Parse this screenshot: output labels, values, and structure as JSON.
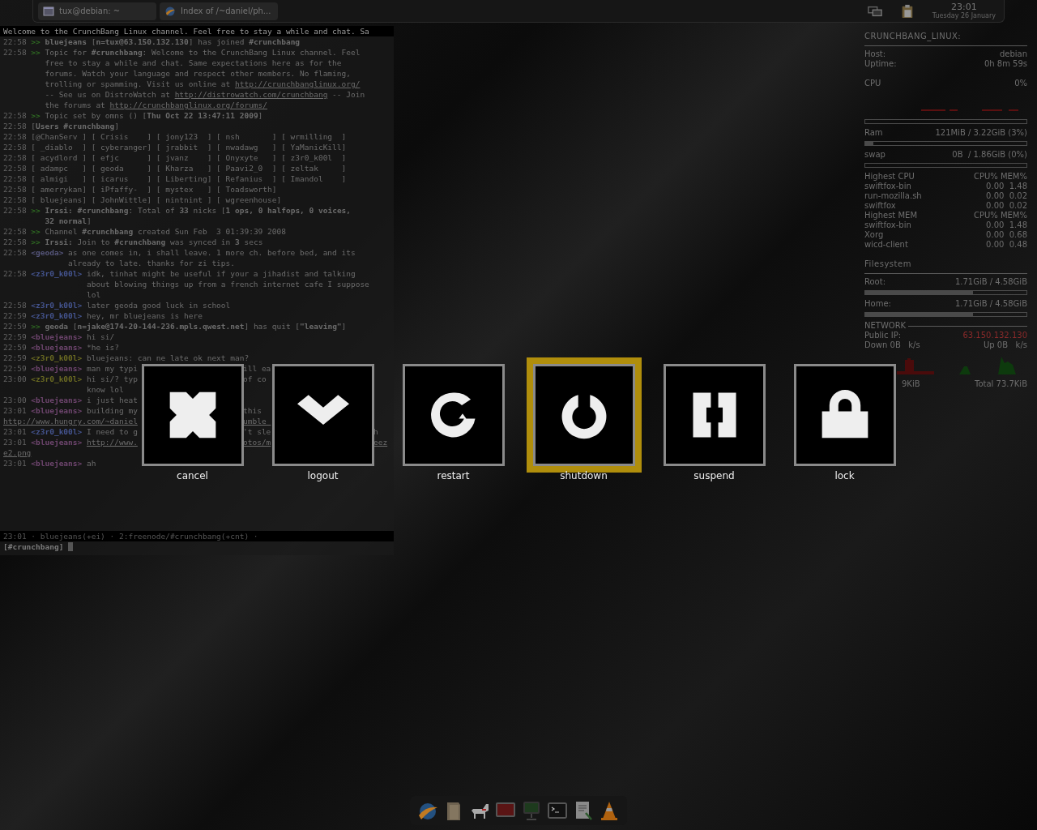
{
  "taskbar": {
    "tasks": [
      {
        "kind": "terminal",
        "title": "tux@debian: ~"
      },
      {
        "kind": "browser",
        "title": "Index of /~daniel/ph..."
      }
    ],
    "clock": {
      "time": "23:01",
      "date": "Tuesday 26 January"
    }
  },
  "terminal": {
    "lines": [
      {
        "kind": "topic-bar",
        "text": "Welcome to the CrunchBang Linux channel. Feel free to stay a while and chat. Sa"
      },
      {
        "kind": "event",
        "time": "22:58",
        "marker": ">>",
        "lines": [
          {
            "text": "**bluejeans** [**n=tux@63.150.132.130**] has joined **#crunchbang**"
          }
        ]
      },
      {
        "kind": "event",
        "time": "22:58",
        "marker": ">>",
        "lines": [
          {
            "text": "Topic for **#crunchbang**: Welcome to the CrunchBang Linux channel. Feel"
          },
          {
            "text": "free to stay a while and chat. Same expectations here as for the"
          },
          {
            "text": "forums. Watch your language and respect other members. No flaming,"
          },
          {
            "text": "trolling or spamming. Visit us online at ",
            "link": "http://crunchbanglinux.org/"
          },
          {
            "text": "-- See us on DistroWatch at ",
            "link": "http://distrowatch.com/crunchbang",
            "after": " -- Join"
          },
          {
            "text": "the forums at ",
            "link": "http://crunchbanglinux.org/forums/"
          }
        ]
      },
      {
        "kind": "event",
        "time": "22:58",
        "marker": ">>",
        "lines": [
          {
            "text": "Topic set by omns () [**Thu Oct 22 13:47:11 2009**]"
          }
        ]
      },
      {
        "kind": "event",
        "time": "22:58",
        "lines": [
          {
            "text": "[**Users #crunchbang**]"
          }
        ]
      },
      {
        "kind": "names",
        "time": "22:58",
        "text": "[@ChanServ ] [ Crisis    ] [ jony123  ] [ nsh       ] [ wrmilling  ]"
      },
      {
        "kind": "names",
        "time": "22:58",
        "text": "[ _diablo  ] [ cyberanger] [ jrabbit  ] [ nwadawg   ] [ YaManicKill]"
      },
      {
        "kind": "names",
        "time": "22:58",
        "text": "[ acydlord ] [ efjc      ] [ jvanz    ] [ Onyxyte   ] [ z3r0_k00l  ]"
      },
      {
        "kind": "names",
        "time": "22:58",
        "text": "[ adampc   ] [ geoda     ] [ Kharza   ] [ Paavi2_0  ] [ zeltak     ]"
      },
      {
        "kind": "names",
        "time": "22:58",
        "text": "[ almigi   ] [ icarus    ] [ Liberting] [ Refanius  ] [ Imandol    ]"
      },
      {
        "kind": "names",
        "time": "22:58",
        "text": "[ amerrykan] [ iPfaffy-  ] [ mystex   ] [ Toadsworth]"
      },
      {
        "kind": "names",
        "time": "22:58",
        "text": "[ bluejeans] [ JohnWittle] [ nintnint ] [ wgreenhouse]"
      },
      {
        "kind": "event",
        "time": "22:58",
        "marker": ">>",
        "lines": [
          {
            "text": "**Irssi:** **#crunchbang**: Total of **33** nicks [**1 ops, 0 halfops, 0 voices,**"
          },
          {
            "text": "**32 normal**]"
          }
        ]
      },
      {
        "kind": "event",
        "time": "22:58",
        "marker": ">>",
        "lines": [
          {
            "text": "Channel **#crunchbang** created Sun Feb  3 01:39:39 2008"
          }
        ]
      },
      {
        "kind": "event",
        "time": "22:58",
        "marker": ">>",
        "lines": [
          {
            "text": "**Irssi:** Join to **#crunchbang** was synced in **3** secs"
          }
        ]
      },
      {
        "kind": "message",
        "time": "22:58",
        "nick": "<geoda>",
        "color": "#55557a",
        "link": false,
        "lines": [
          [
            "as one comes in, i shall leave. 1 more ch. before bed, and its"
          ],
          [
            "already to late. thanks for zi tips."
          ]
        ]
      },
      {
        "kind": "message",
        "time": "22:58",
        "nick": "<z3r0_k00l>",
        "color": "#44548f",
        "link": false,
        "lines": [
          [
            "idk, tinhat might be useful if your a jihadist and talking"
          ],
          [
            "about blowing things up from a french internet cafe I suppose"
          ],
          [
            "lol"
          ]
        ]
      },
      {
        "kind": "message",
        "time": "22:58",
        "nick": "<z3r0_k00l>",
        "color": "#44548f",
        "link": false,
        "lines": [
          [
            "later geoda good luck in school"
          ]
        ]
      },
      {
        "kind": "message",
        "time": "22:59",
        "nick": "<z3r0_k00l>",
        "color": "#44548f",
        "link": false,
        "lines": [
          [
            "hey, mr bluejeans is here"
          ]
        ]
      },
      {
        "kind": "event",
        "time": "22:59",
        "marker": ">>",
        "lines": [
          {
            "text": "**geoda** [**n=jake@174-20-144-236.mpls.qwest.net**] has quit [**\"leaving\"**]"
          }
        ]
      },
      {
        "kind": "message",
        "time": "22:59",
        "nick": "<bluejeans>",
        "color": "#6e456e",
        "link": false,
        "lines": [
          [
            "hi si/"
          ]
        ]
      },
      {
        "kind": "message",
        "time": "22:59",
        "nick": "<bluejeans>",
        "color": "#6e456e",
        "link": false,
        "lines": [
          [
            "*he is?"
          ]
        ]
      },
      {
        "kind": "message",
        "time": "22:59",
        "nick": "<z3r0_k00l>",
        "color": "#6b6b22",
        "link": false,
        "lines": [
          [
            "bluejeans: can ne late ok next man?"
          ]
        ]
      },
      {
        "kind": "message",
        "time": "22:59",
        "nick": "<bluejeans>",
        "color": "#6e456e",
        "link": false,
        "lines": [
          [
            "man my typi",
            "ill ea"
          ]
        ]
      },
      {
        "kind": "message",
        "time": "23:00",
        "nick": "<z3r0_k00l>",
        "color": "#6b6b22",
        "link": false,
        "lines": [
          [
            "hi si/? typ",
            "of co"
          ],
          [
            "know lol"
          ]
        ]
      },
      {
        "kind": "message",
        "time": "23:00",
        "nick": "<bluejeans>",
        "color": "#6e456e",
        "link": false,
        "lines": [
          [
            "i just heat"
          ]
        ]
      },
      {
        "kind": "message",
        "time": "23:01",
        "nick": "<bluejeans>",
        "color": "#6e456e",
        "link": false,
        "lines": [
          [
            "building my",
            "this"
          ]
        ]
      },
      {
        "kind": "bare",
        "link": true,
        "lines": [
          [
            "http://www.hungry.com/~daniel",
            "umble_"
          ]
        ]
      },
      {
        "kind": "message",
        "time": "23:01",
        "nick": "<z3r0_k00l>",
        "color": "#44548f",
        "link": false,
        "lines": [
          [
            "I need to g",
            "'t sle",
            "h"
          ]
        ]
      },
      {
        "kind": "message",
        "time": "23:01",
        "nick": "<bluejeans>",
        "color": "#6e456e",
        "link": true,
        "lines": [
          [
            "http://www.",
            "otos/m",
            "eez"
          ]
        ]
      },
      {
        "kind": "bare",
        "link": true,
        "lines": [
          [
            "e2.png"
          ]
        ]
      },
      {
        "kind": "message",
        "time": "23:01",
        "nick": "<bluejeans>",
        "color": "#6e456e",
        "link": false,
        "lines": [
          [
            "ah"
          ]
        ]
      }
    ],
    "status_bar": "23:01 · bluejeans(+ei) · 2:freenode/#crunchbang(+cnt) ·",
    "prompt": "[#crunchbang]"
  },
  "conky": {
    "title": "CRUNCHBANG_LINUX:",
    "info": [
      {
        "label": "Host:",
        "value": "debian"
      },
      {
        "label": "Uptime:",
        "value": "0h 8m 59s"
      }
    ],
    "cpu": {
      "label": "CPU",
      "value": "0%",
      "level": 0
    },
    "memory": [
      {
        "label": "Ram",
        "value": "121MiB / 3.22GiB (3%)",
        "level": 0.05
      },
      {
        "label": "swap",
        "value": "0B  / 1.86GiB (0%)",
        "level": 0
      }
    ],
    "process_tables": [
      {
        "title": "Highest CPU",
        "columns": "CPU% MEM%",
        "rows": [
          {
            "name": "swiftfox-bin",
            "values": "0.00  1.48"
          },
          {
            "name": "run-mozilla.sh",
            "values": "0.00  0.02"
          },
          {
            "name": "swiftfox",
            "values": "0.00  0.02"
          }
        ]
      },
      {
        "title": "Highest MEM",
        "columns": "CPU% MEM%",
        "rows": [
          {
            "name": "swiftfox-bin",
            "values": "0.00  1.48"
          },
          {
            "name": "Xorg",
            "values": "0.00  0.68"
          },
          {
            "name": "wicd-client",
            "values": "0.00  0.48"
          }
        ]
      }
    ],
    "filesystem": {
      "title": "Filesystem",
      "mounts": [
        {
          "label": "Root:",
          "value": "1.71GiB / 4.58GiB",
          "level": 0.67
        },
        {
          "label": "Home:",
          "value": "1.71GiB / 4.58GiB",
          "level": 0.67
        }
      ]
    },
    "network": {
      "title": "NETWORK",
      "ip_label": "Public IP:",
      "ip": "63.150.132.130",
      "down": "Down 0B   k/s",
      "up": "Up 0B   k/s",
      "down_total": "9KiB",
      "up_total": "Total 73.7KiB"
    }
  },
  "dialog": {
    "buttons": [
      {
        "kind": "cancel",
        "label": "cancel",
        "selected": false
      },
      {
        "kind": "logout",
        "label": "logout",
        "selected": false
      },
      {
        "kind": "restart",
        "label": "restart",
        "selected": false
      },
      {
        "kind": "shutdown",
        "label": "shutdown",
        "selected": true
      },
      {
        "kind": "suspend",
        "label": "suspend",
        "selected": false
      },
      {
        "kind": "lock",
        "label": "lock",
        "selected": false
      }
    ]
  },
  "dock": {
    "items": [
      {
        "kind": "browser"
      },
      {
        "kind": "files"
      },
      {
        "kind": "mascot"
      },
      {
        "kind": "screen"
      },
      {
        "kind": "display"
      },
      {
        "kind": "terminal"
      },
      {
        "kind": "editor"
      },
      {
        "kind": "player"
      }
    ]
  }
}
